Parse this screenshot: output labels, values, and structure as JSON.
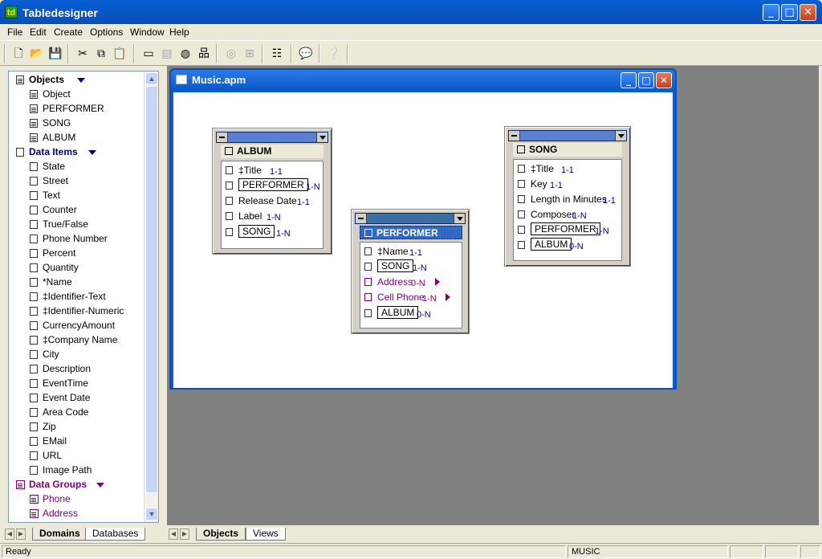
{
  "app": {
    "title": "Tabledesigner",
    "icon_text": "td"
  },
  "window_controls": {
    "minimize": "_",
    "maximize": "□",
    "close": "✕"
  },
  "menu": [
    "File",
    "Edit",
    "Create",
    "Options",
    "Window",
    "Help"
  ],
  "toolbar": [
    {
      "name": "new-icon",
      "glyph": "🗋"
    },
    {
      "name": "open-icon",
      "glyph": "📂"
    },
    {
      "name": "save-icon",
      "glyph": "💾"
    },
    {
      "name": "cut-icon",
      "glyph": "✂"
    },
    {
      "name": "copy-icon",
      "glyph": "⧉"
    },
    {
      "name": "paste-icon",
      "glyph": "📋",
      "disabled": true
    },
    {
      "name": "table-icon",
      "glyph": "▭"
    },
    {
      "name": "form-icon",
      "glyph": "▤",
      "disabled": true
    },
    {
      "name": "database-icon",
      "glyph": "◍"
    },
    {
      "name": "hierarchy-icon",
      "glyph": "品"
    },
    {
      "name": "globe-icon",
      "glyph": "◎",
      "disabled": true
    },
    {
      "name": "grid-icon",
      "glyph": "⊞",
      "disabled": true
    },
    {
      "name": "properties-icon",
      "glyph": "☷"
    },
    {
      "name": "comment-icon",
      "glyph": "💬"
    },
    {
      "name": "help-icon",
      "glyph": "❔"
    }
  ],
  "tree": {
    "objects_header": "Objects",
    "objects": [
      "Object",
      "PERFORMER",
      "SONG",
      "ALBUM"
    ],
    "data_items_header": "Data Items",
    "data_items": [
      "State",
      "Street",
      "Text",
      "Counter",
      "True/False",
      "Phone Number",
      "Percent",
      "Quantity",
      "*Name",
      "‡Identifier-Text",
      "‡Identifier-Numeric",
      "CurrencyAmount",
      "‡Company Name",
      "City",
      "Description",
      "EventTime",
      "Event Date",
      "Area Code",
      "Zip",
      "EMail",
      "URL",
      "Image Path"
    ],
    "data_groups_header": "Data Groups",
    "data_groups": [
      "Phone",
      "Address"
    ]
  },
  "left_tabs": [
    "Domains",
    "Databases"
  ],
  "main_tabs": [
    "Objects",
    "Views"
  ],
  "child_window": {
    "title": "Music.apm"
  },
  "objects": [
    {
      "title": "ALBUM",
      "attrs": [
        {
          "name": "‡Title",
          "card": "1-1",
          "type": "item"
        },
        {
          "name": "PERFORMER",
          "card": "1-N",
          "type": "ref"
        },
        {
          "name": "Release Date",
          "card": "1-1",
          "type": "item"
        },
        {
          "name": "Label",
          "card": "1-N",
          "type": "item"
        },
        {
          "name": "SONG",
          "card": "1-N",
          "type": "ref"
        }
      ]
    },
    {
      "title": "PERFORMER",
      "attrs": [
        {
          "name": "‡Name",
          "card": "1-1",
          "type": "item"
        },
        {
          "name": "SONG",
          "card": "1-N",
          "type": "ref"
        },
        {
          "name": "Address",
          "card": "0-N",
          "type": "group"
        },
        {
          "name": "Cell Phone",
          "card": "1-N",
          "type": "group"
        },
        {
          "name": "ALBUM",
          "card": "0-N",
          "type": "ref"
        }
      ]
    },
    {
      "title": "SONG",
      "attrs": [
        {
          "name": "‡Title",
          "card": "1-1",
          "type": "item"
        },
        {
          "name": "Key",
          "card": "1-1",
          "type": "item"
        },
        {
          "name": "Length in Minutes",
          "card": "1-1",
          "type": "item"
        },
        {
          "name": "Composer",
          "card": "1-N",
          "type": "item"
        },
        {
          "name": "PERFORMER",
          "card": "1-N",
          "type": "ref"
        },
        {
          "name": "ALBUM",
          "card": "0-N",
          "type": "ref"
        }
      ]
    }
  ],
  "status": {
    "left": "Ready",
    "middle": "MUSIC"
  }
}
